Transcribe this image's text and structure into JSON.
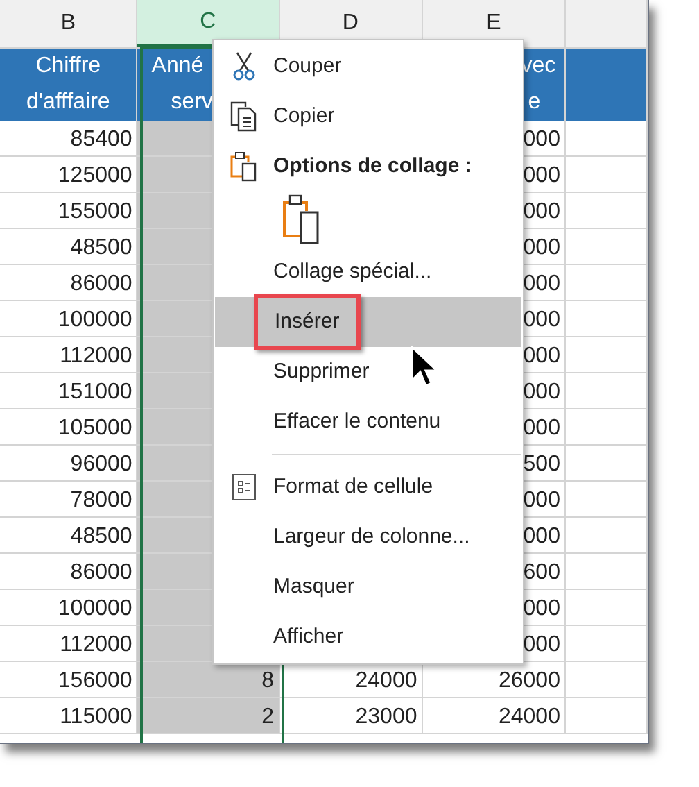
{
  "column_headers": [
    {
      "label": "B",
      "selected": false
    },
    {
      "label": "C",
      "selected": true
    },
    {
      "label": "D",
      "selected": false
    },
    {
      "label": "E",
      "selected": false
    }
  ],
  "table": {
    "header": {
      "B": [
        "Chiffre",
        "d'afffaire"
      ],
      "C": [
        "Anné",
        "serv"
      ],
      "E": [
        "vec",
        "e"
      ]
    },
    "rows": [
      {
        "B": "85400",
        "E": "000"
      },
      {
        "B": "125000",
        "E": "000"
      },
      {
        "B": "155000",
        "E": "000"
      },
      {
        "B": "48500",
        "E": "000"
      },
      {
        "B": "86000",
        "E": "000"
      },
      {
        "B": "100000",
        "E": "000"
      },
      {
        "B": "112000",
        "E": "000"
      },
      {
        "B": "151000",
        "E": "000"
      },
      {
        "B": "105000",
        "E": "000"
      },
      {
        "B": "96000",
        "E": "500"
      },
      {
        "B": "78000",
        "E": "000"
      },
      {
        "B": "48500",
        "E": "000"
      },
      {
        "B": "86000",
        "E": "600"
      },
      {
        "B": "100000",
        "E": "000"
      },
      {
        "B": "112000",
        "E": "000"
      },
      {
        "B": "156000",
        "C": "8",
        "D": "24000",
        "E": "26000"
      },
      {
        "B": "115000",
        "C": "2",
        "D": "23000",
        "E": "24000"
      }
    ]
  },
  "context_menu": {
    "items": [
      {
        "kind": "item",
        "label": "Couper",
        "selected": false
      },
      {
        "kind": "item",
        "label": "Copier",
        "selected": false
      },
      {
        "kind": "heading",
        "label": "Options de collage :"
      },
      {
        "kind": "paste-option"
      },
      {
        "kind": "item",
        "label": "Collage spécial...",
        "selected": false
      },
      {
        "kind": "item",
        "label": "Insérer",
        "selected": true
      },
      {
        "kind": "item",
        "label": "Supprimer",
        "selected": false
      },
      {
        "kind": "item",
        "label": "Effacer le contenu",
        "selected": false
      },
      {
        "kind": "separator"
      },
      {
        "kind": "item",
        "label": "Format de cellule",
        "selected": false
      },
      {
        "kind": "item",
        "label": "Largeur de colonne...",
        "selected": false
      },
      {
        "kind": "item",
        "label": "Masquer",
        "selected": false
      },
      {
        "kind": "item",
        "label": "Afficher",
        "selected": false
      }
    ]
  }
}
